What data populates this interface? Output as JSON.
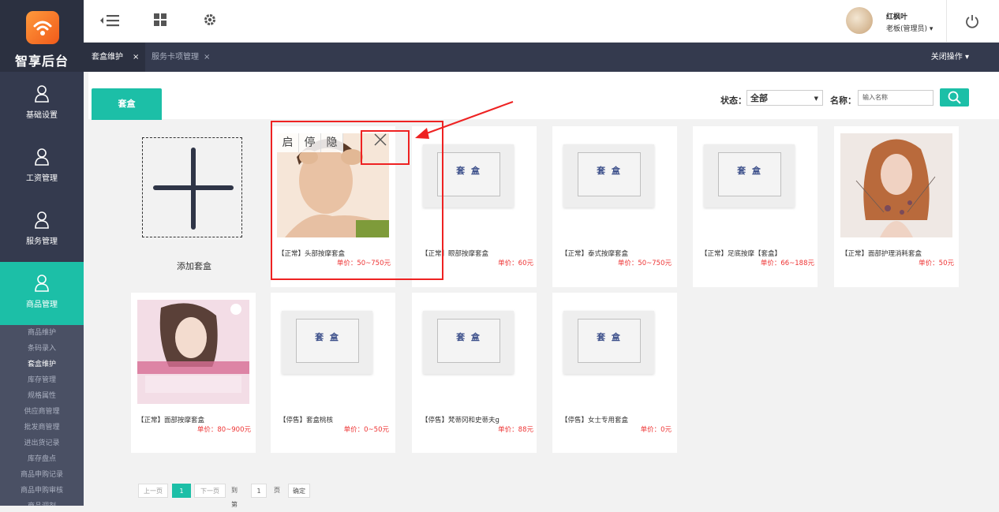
{
  "app": {
    "name": "智享后台"
  },
  "sidebar": {
    "nav": [
      {
        "label": "基础设置",
        "icon": "user-icon"
      },
      {
        "label": "工资管理",
        "icon": "user-icon"
      },
      {
        "label": "服务管理",
        "icon": "user-icon"
      },
      {
        "label": "商品管理",
        "icon": "user-icon",
        "active": true
      }
    ],
    "submenu": [
      "商品维护",
      "条码录入",
      "套盒维护",
      "库存管理",
      "规格属性",
      "供应商管理",
      "批发商管理",
      "进出货记录",
      "库存盘点",
      "商品申购记录",
      "商品申购审核",
      "商品调剂"
    ],
    "current_sub": "套盒维护"
  },
  "header": {
    "user_name": "红枫叶",
    "user_role": "老板(管理员) ▾",
    "icons": [
      "menu-collapse-icon",
      "grid-icon",
      "gear-icon",
      "power-icon"
    ]
  },
  "tabs": {
    "items": [
      {
        "label": "套盒维护",
        "close": "×",
        "active": true
      },
      {
        "label": "服务卡项管理",
        "close": "×"
      }
    ],
    "close_ops": "关闭操作 ▾"
  },
  "main": {
    "content_tab": "套盒",
    "filter": {
      "status_label": "状态：",
      "status_value": "全部",
      "name_label": "名称：",
      "name_placeholder": "输入名称"
    },
    "add_label": "添加套盒",
    "ops": {
      "enable": "启",
      "stop": "停",
      "hide": "隐"
    },
    "box_word": "套 盒",
    "cards": [
      {
        "title": "【正常】头部按摩套盒",
        "price": "单价：50~750元",
        "image": "photo-head-massage"
      },
      {
        "title": "【正常】眼部按摩套盒",
        "price": "单价：60元",
        "image": "box-placeholder"
      },
      {
        "title": "【正常】泰式按摩套盒",
        "price": "单价：50~750元",
        "image": "box-placeholder"
      },
      {
        "title": "【正常】足底按摩【套盒】",
        "price": "单价：66~188元",
        "image": "box-placeholder"
      },
      {
        "title": "【正常】面部护理消耗套盒",
        "price": "单价：50元",
        "image": "photo-model"
      },
      {
        "title": "【正常】面部按摩套盒",
        "price": "单价：80~900元",
        "image": "photo-beauty-poster"
      },
      {
        "title": "【停售】套盒桃核",
        "price": "单价：0~50元",
        "image": "box-placeholder"
      },
      {
        "title": "【停售】梵蒂冈和史蒂夫g",
        "price": "单价：88元",
        "image": "box-placeholder"
      },
      {
        "title": "【停售】女士专用套盒",
        "price": "单价：0元",
        "image": "box-placeholder"
      }
    ]
  },
  "pager": {
    "prev": "上一页",
    "current": "1",
    "next": "下一页",
    "goto": "到第",
    "page_input": "1",
    "page_unit": "页",
    "confirm": "确定"
  },
  "colors": {
    "accent": "#1cbfa7",
    "sidebar": "#343a4e",
    "price": "#e33333",
    "annotation": "#e22222"
  }
}
